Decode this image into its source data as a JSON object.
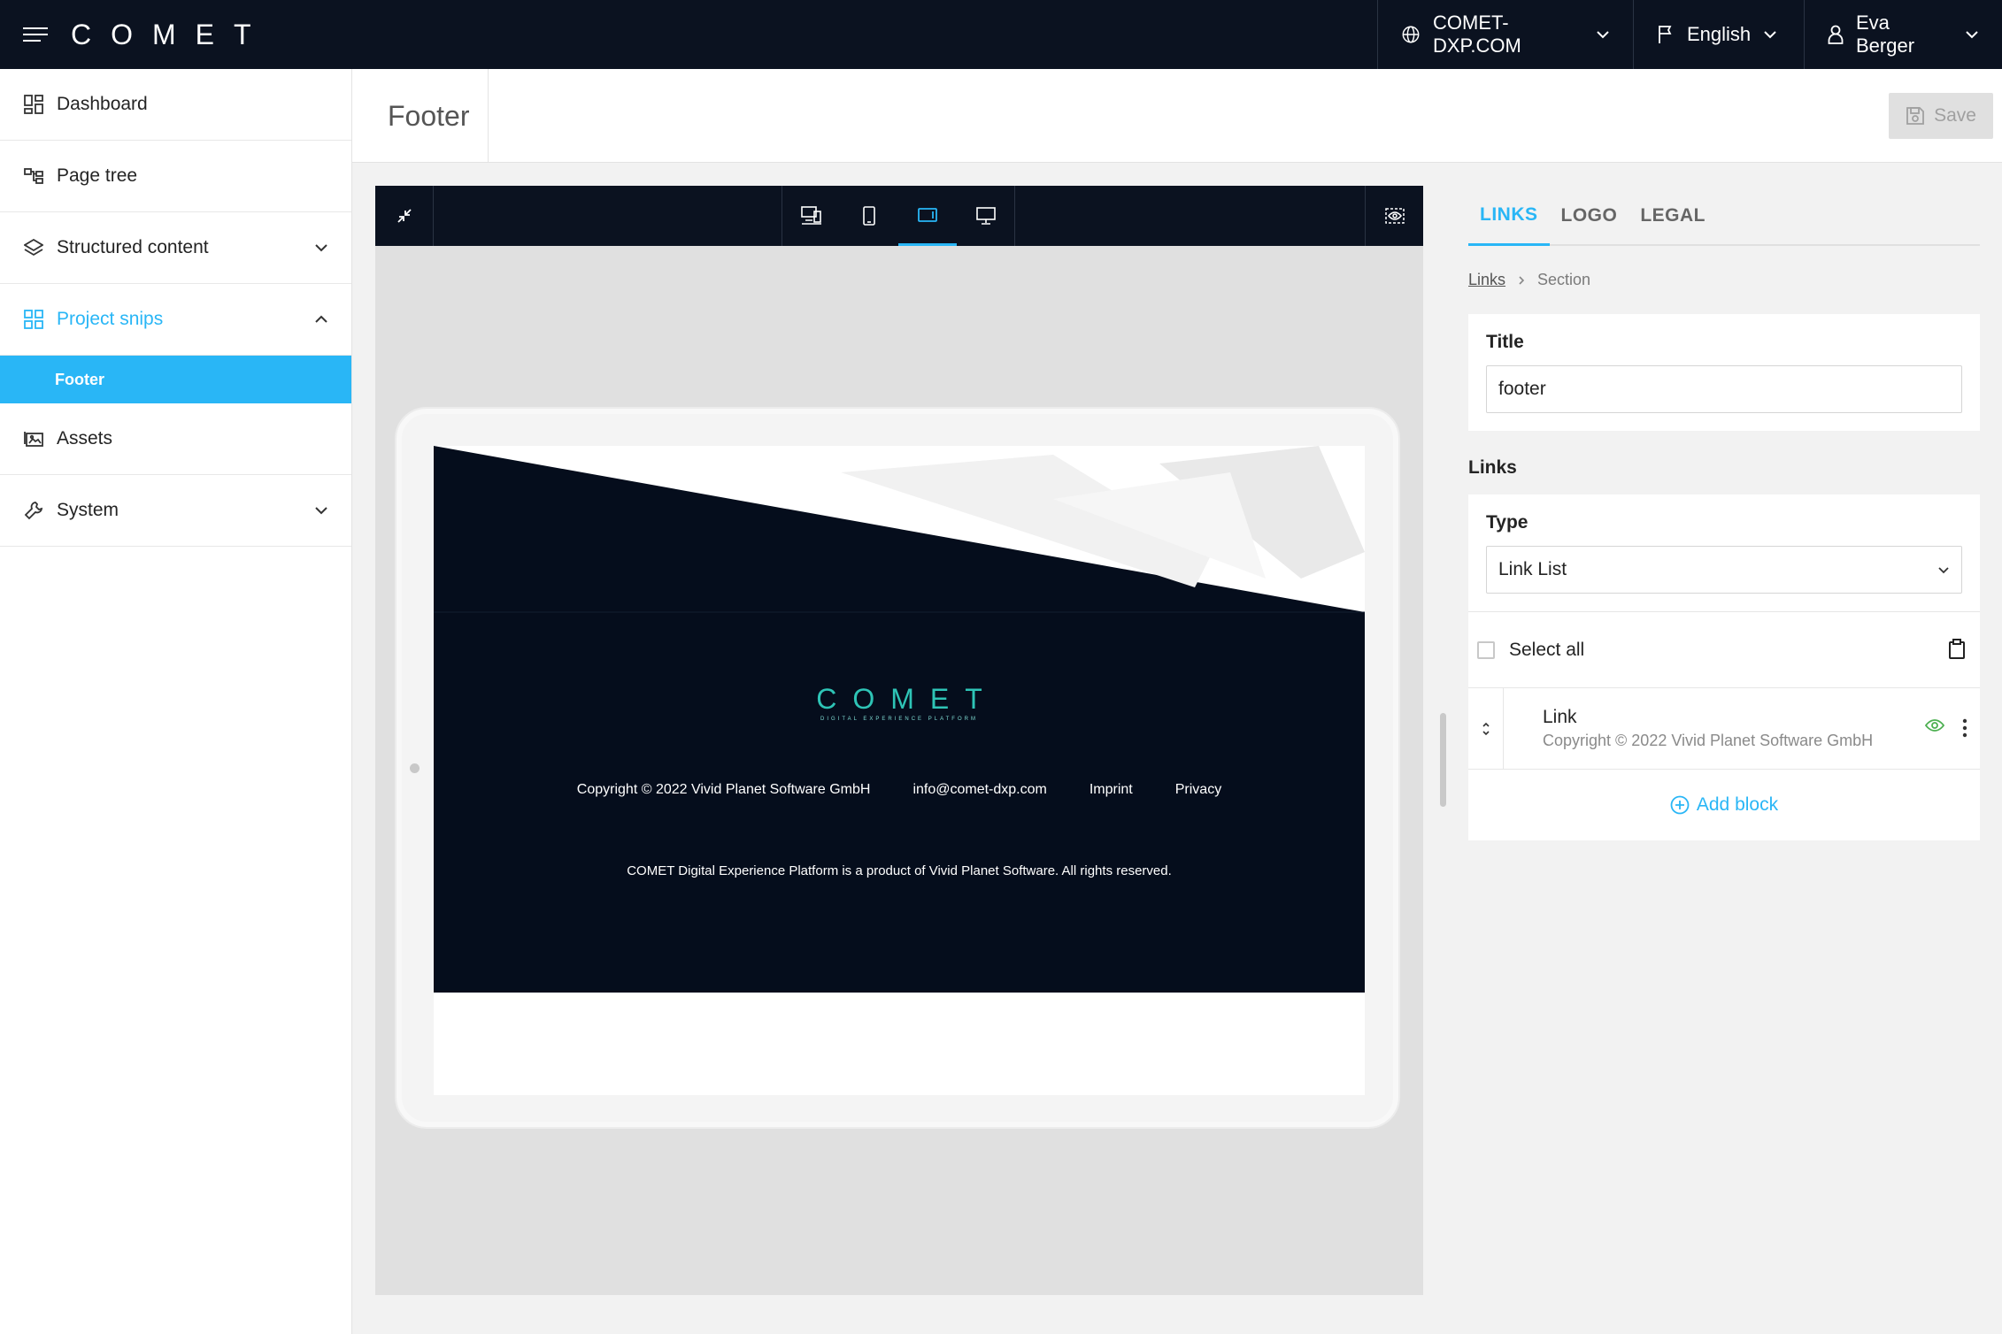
{
  "topbar": {
    "brand": [
      "C",
      "O",
      "M",
      "E",
      "T"
    ],
    "domain": "COMET-DXP.COM",
    "language": "English",
    "user": "Eva Berger"
  },
  "sidebar": {
    "items": [
      {
        "label": "Dashboard",
        "icon": "dashboard-icon"
      },
      {
        "label": "Page tree",
        "icon": "page-tree-icon"
      },
      {
        "label": "Structured content",
        "icon": "layers-icon"
      },
      {
        "label": "Project snips",
        "icon": "snips-icon"
      },
      {
        "label": "Footer"
      },
      {
        "label": "Assets",
        "icon": "assets-icon"
      },
      {
        "label": "System",
        "icon": "wrench-icon"
      }
    ]
  },
  "header": {
    "title": "Footer",
    "save_label": "Save"
  },
  "preview": {
    "active_device": "tablet",
    "footer_logo": [
      "C",
      "O",
      "M",
      "E",
      "T"
    ],
    "footer_tagline": "DIGITAL EXPERIENCE PLATFORM",
    "footer_links": [
      "Copyright © 2022 Vivid Planet Software GmbH",
      "info@comet-dxp.com",
      "Imprint",
      "Privacy"
    ],
    "footer_note": "COMET Digital Experience Platform is a product of Vivid Planet Software. All rights reserved.",
    "footer_bg": "#050d1c"
  },
  "panel": {
    "tabs": [
      "LINKS",
      "LOGO",
      "LEGAL"
    ],
    "active_tab": "LINKS",
    "breadcrumb": {
      "link": "Links",
      "current": "Section"
    },
    "title_label": "Title",
    "title_value": "footer",
    "links_label": "Links",
    "type_label": "Type",
    "type_value": "Link List",
    "select_all": "Select all",
    "block": {
      "title": "Link",
      "subtitle": "Copyright © 2022 Vivid Planet Software GmbH"
    },
    "add_block": "Add block"
  },
  "colors": {
    "accent": "#29b6f6",
    "topbar": "#0b1220",
    "visible_eye": "#4caf50",
    "logo_teal": "#2ec4b6"
  }
}
